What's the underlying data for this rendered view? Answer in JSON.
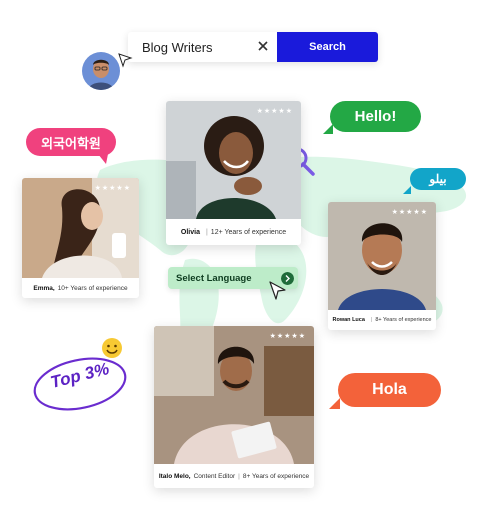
{
  "search": {
    "value": "Blog Writers",
    "button_label": "Search"
  },
  "bubbles": {
    "korean": "외국어학원",
    "hello": "Hello!",
    "arabic": "بيلو",
    "hola": "Hola"
  },
  "badge": {
    "top_label": "Top 3%"
  },
  "select_language": {
    "label": "Select Language"
  },
  "cards": [
    {
      "name": "Olivia",
      "detail": "12+ Years of experience",
      "stars": "★★★★★"
    },
    {
      "name": "Emma,",
      "detail": "10+ Years of experience",
      "stars": "★★★★★"
    },
    {
      "name": "Rowan Luca",
      "detail": "8+ Years of experience",
      "stars": "★★★★★"
    },
    {
      "name": "Italo Melo,",
      "role": "Content Editor",
      "detail": "8+ Years of experience",
      "stars": "★★★★★"
    }
  ],
  "colors": {
    "search_button": "#1a1adb",
    "hello_bubble": "#23a845",
    "hola_bubble": "#f3623a",
    "korean_bubble": "#f0417e",
    "arabic_bubble": "#12a5c9",
    "map": "#dbf5e6",
    "top_badge": "#6a2ccf"
  },
  "icons": [
    "clear-icon",
    "magnifier-icon",
    "pointer-cursor-icon",
    "smiley-icon",
    "arrow-right-icon"
  ]
}
